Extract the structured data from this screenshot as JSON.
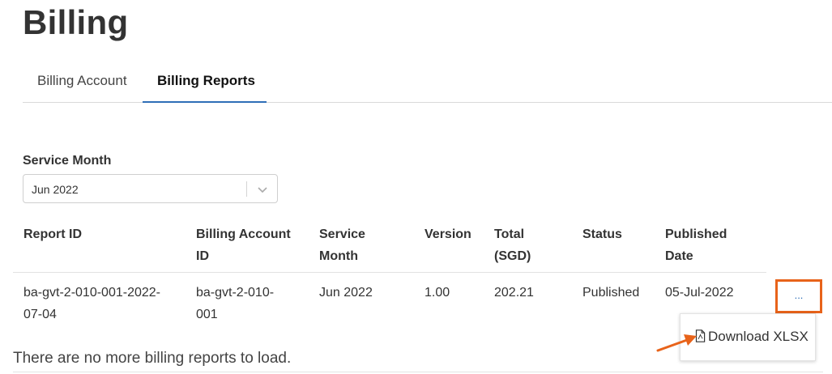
{
  "page": {
    "title": "Billing"
  },
  "tabs": [
    {
      "label": "Billing Account"
    },
    {
      "label": "Billing Reports"
    }
  ],
  "filter": {
    "label": "Service Month",
    "value": "Jun 2022"
  },
  "table": {
    "headers": {
      "report_id": "Report ID",
      "billing_account_line1": "Billing Account",
      "billing_account_line2": "ID",
      "service_month_line1": "Service",
      "service_month_line2": "Month",
      "version": "Version",
      "total_line1": "Total",
      "total_line2": "(SGD)",
      "status": "Status",
      "published_line1": "Published",
      "published_line2": "Date"
    },
    "rows": [
      {
        "report_id_line1": "ba-gvt-2-010-001-2022-",
        "report_id_line2": "07-04",
        "billing_account_line1": "ba-gvt-2-010-",
        "billing_account_line2": "001",
        "service_month": "Jun 2022",
        "version": "1.00",
        "total": "202.21",
        "status": "Published",
        "published_date": "05-Jul-2022",
        "actions_label": "..."
      }
    ]
  },
  "menu": {
    "download_label": "Download XLSX"
  },
  "footer": {
    "message": "There are no more billing reports to load."
  },
  "colors": {
    "accent": "#2f6fb7",
    "highlight": "#e8631a"
  },
  "icons": {
    "select": "chevron-down-icon",
    "download": "file-icon",
    "annotation": "arrow-icon"
  }
}
